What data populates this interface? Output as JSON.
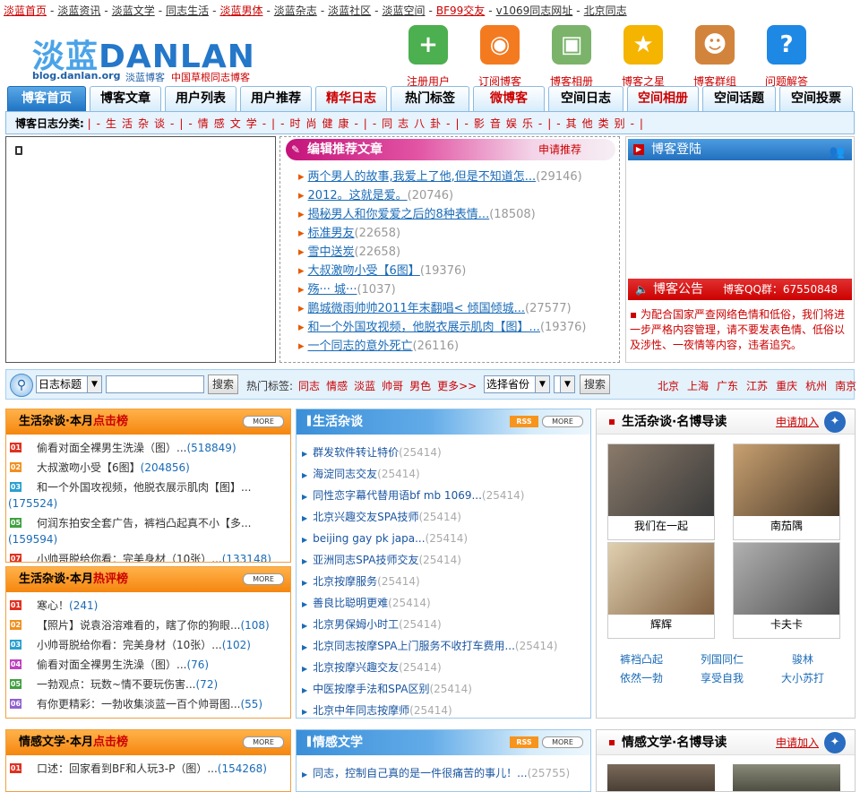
{
  "topnav": [
    {
      "label": "淡蓝首页",
      "style": "red"
    },
    {
      "label": "淡蓝资讯",
      "style": "normal"
    },
    {
      "label": "淡蓝文学",
      "style": "normal"
    },
    {
      "label": "同志生活",
      "style": "normal"
    },
    {
      "label": "淡蓝男体",
      "style": "red"
    },
    {
      "label": "淡蓝杂志",
      "style": "normal"
    },
    {
      "label": "淡蓝社区",
      "style": "normal"
    },
    {
      "label": "淡蓝空间",
      "style": "normal"
    },
    {
      "label": "BF99交友",
      "style": "red"
    },
    {
      "label": "v1069同志网址",
      "style": "plain"
    },
    {
      "label": "北京同志",
      "style": "plain"
    }
  ],
  "logo": {
    "cn": "淡蓝",
    "en": "DANLAN",
    "url": "blog.danlan.org",
    "slogan_blue": "淡蓝博客",
    "slogan_red": "中国草根同志博客"
  },
  "header_icons": [
    {
      "label": "注册用户",
      "icon": "add-user-icon",
      "color": "#4caf50",
      "glyph": "+"
    },
    {
      "label": "订阅博客",
      "icon": "rss-icon",
      "color": "#f47a20",
      "glyph": "◉"
    },
    {
      "label": "博客相册",
      "icon": "photo-album-icon",
      "color": "#7bb36a",
      "glyph": "▣"
    },
    {
      "label": "博客之星",
      "icon": "star-icon",
      "color": "#f4b400",
      "glyph": "★"
    },
    {
      "label": "博客群组",
      "icon": "group-icon",
      "color": "#d2843c",
      "glyph": "☻"
    },
    {
      "label": "问题解答",
      "icon": "help-icon",
      "color": "#1e88e5",
      "glyph": "?"
    }
  ],
  "tabs": [
    {
      "label": "博客首页",
      "style": "active"
    },
    {
      "label": "博客文章",
      "style": "normal"
    },
    {
      "label": "用户列表",
      "style": "normal"
    },
    {
      "label": "用户推荐",
      "style": "normal"
    },
    {
      "label": "精华日志",
      "style": "red"
    },
    {
      "label": "热门标签",
      "style": "normal"
    },
    {
      "label": "微博客",
      "style": "red"
    },
    {
      "label": "空间日志",
      "style": "normal"
    },
    {
      "label": "空间相册",
      "style": "red"
    },
    {
      "label": "空间话题",
      "style": "normal"
    },
    {
      "label": "空间投票",
      "style": "normal"
    }
  ],
  "categories": {
    "label": "博客日志分类:",
    "items": [
      "|-生活杂谈-|",
      "-情感文学-|",
      "-时尚健康-|",
      "-同志八卦-|",
      "-影音娱乐-|",
      "-其他类别-|"
    ]
  },
  "featured": {
    "title": "编辑推荐文章",
    "apply": "申请推荐",
    "items": [
      {
        "title": "两个男人的故事,我爱上了他,但是不知道怎...",
        "count": "(29146)"
      },
      {
        "title": "2012。这就是爱。",
        "count": "(20746)"
      },
      {
        "title": "揭秘男人和你爱爱之后的8种表情...",
        "count": "(18508)"
      },
      {
        "title": "标准男友",
        "count": "(22658)"
      },
      {
        "title": "雪中送炭",
        "count": "(22658)"
      },
      {
        "title": "大叔激吻小受【6图】",
        "count": "(19376)"
      },
      {
        "title": "殇··· 城···",
        "count": "(1037)"
      },
      {
        "title": "鹏城微雨帅帅2011年末翻唱< 倾国倾城...",
        "count": "(27577)"
      },
      {
        "title": "和一个外国攻视频，他脱衣展示肌肉【图】...",
        "count": "(19376)"
      },
      {
        "title": "一个同志的意外死亡",
        "count": "(26116)"
      }
    ]
  },
  "login_box": {
    "title": "博客登陆"
  },
  "notice_box": {
    "title": "博客公告",
    "qq": "博客QQ群：67550848",
    "text": "▪ 为配合国家严查网络色情和低俗，我们将进一步严格内容管理，请不要发表色情、低俗以及涉性、一夜情等内容，违者追究。"
  },
  "search": {
    "type_select": "日志标题",
    "button": "搜索",
    "hot_label": "热门标签:",
    "hot_tags": [
      "同志",
      "情感",
      "淡蓝",
      "帅哥",
      "男色",
      "更多>>"
    ],
    "province_select": "选择省份",
    "button2": "搜索",
    "cities": [
      "北京",
      "上海",
      "广东",
      "江苏",
      "重庆",
      "杭州",
      "南京"
    ]
  },
  "more_label": "MORE",
  "rss_label": "RSS",
  "rank_click": {
    "title_a": "生活杂谈·本月",
    "title_b": "点击榜",
    "items": [
      {
        "num": "01",
        "text": "偷看对面全裸男生洗澡（图）...",
        "count": "(518849)"
      },
      {
        "num": "02",
        "text": "大叔激吻小受【6图】",
        "count": "(204856)"
      },
      {
        "num": "03",
        "text": "和一个外国攻视频，他脱衣展示肌肉【图】...",
        "count": ""
      },
      {
        "num": "04",
        "text": "",
        "count": "(175524)"
      },
      {
        "num": "05",
        "text": "何润东拍安全套广告，裤裆凸起真不小【多...",
        "count": ""
      },
      {
        "num": "06",
        "text": "",
        "count": "(159594)"
      },
      {
        "num": "07",
        "text": "小帅哥脱给你看：完美身材（10张）...",
        "count": "(133148)"
      }
    ]
  },
  "rank_comment": {
    "title_a": "生活杂谈·本月",
    "title_b": "热评榜",
    "items": [
      {
        "num": "01",
        "text": "寒心！",
        "count": "(241)"
      },
      {
        "num": "02",
        "text": "【照片】说袁浴溶难看的，瞎了你的狗眼...",
        "count": "(108)"
      },
      {
        "num": "03",
        "text": "小帅哥脱给你看：完美身材（10张）...",
        "count": "(102)"
      },
      {
        "num": "04",
        "text": "偷看对面全裸男生洗澡（图）...",
        "count": "(76)"
      },
      {
        "num": "05",
        "text": "一勃观点：玩数~情不要玩伤害...",
        "count": "(72)"
      },
      {
        "num": "06",
        "text": "有你更精彩：一勃收集淡蓝一百个帅哥图...",
        "count": "(55)"
      }
    ]
  },
  "life_list": {
    "title": "生活杂谈",
    "items": [
      {
        "title": "群发软件转让特价",
        "count": "(25414)"
      },
      {
        "title": "海淀同志交友",
        "count": "(25414)"
      },
      {
        "title": "同性恋字幕代替用语bf mb 1069...",
        "count": "(25414)"
      },
      {
        "title": "北京兴趣交友SPA技师",
        "count": "(25414)"
      },
      {
        "title": "beijing gay pk japa...",
        "count": "(25414)"
      },
      {
        "title": "亚洲同志SPA技师交友",
        "count": "(25414)"
      },
      {
        "title": "北京按摩服务",
        "count": "(25414)"
      },
      {
        "title": "善良比聪明更难",
        "count": "(25414)"
      },
      {
        "title": "北京男保姆小时工",
        "count": "(25414)"
      },
      {
        "title": "北京同志按摩SPA上门服务不收打车费用...",
        "count": "(25414)"
      },
      {
        "title": "北京按摩兴趣交友",
        "count": "(25414)"
      },
      {
        "title": "中医按摩手法和SPA区别",
        "count": "(25414)"
      },
      {
        "title": "北京中年同志按摩师",
        "count": "(25414)"
      }
    ]
  },
  "life_famous": {
    "title": "生活杂谈·名博导读",
    "apply": "申请加入",
    "photos": [
      {
        "caption": "我们在一起",
        "color1": "#8a7a6a",
        "color2": "#3a3a3a"
      },
      {
        "caption": "南茄隅",
        "color1": "#c8a070",
        "color2": "#4a3a2a"
      },
      {
        "caption": "辉辉",
        "color1": "#e0d0b0",
        "color2": "#806040"
      },
      {
        "caption": "卡夫卡",
        "color1": "#b0b0b0",
        "color2": "#505050"
      }
    ],
    "links": [
      "裤裆凸起",
      "列国同仁",
      "骏林",
      "依然一勃",
      "享受自我",
      "大小苏打"
    ]
  },
  "lit_rank": {
    "title_a": "情感文学·本月",
    "title_b": "点击榜",
    "items": [
      {
        "num": "01",
        "text": "口述：回家看到BF和人玩3-P（图）...",
        "count": "(154268)"
      }
    ]
  },
  "lit_list": {
    "title": "情感文学",
    "items": [
      {
        "title": "同志，控制自己真的是一件很痛苦的事儿！...",
        "count": "(25755)"
      }
    ]
  },
  "lit_famous": {
    "title": "情感文学·名博导读",
    "apply": "申请加入"
  },
  "rank_colors": [
    "#e03020",
    "#f09020",
    "#2aa0d0",
    "#c040c0",
    "#40a040",
    "#9060d0",
    "#e03020"
  ]
}
